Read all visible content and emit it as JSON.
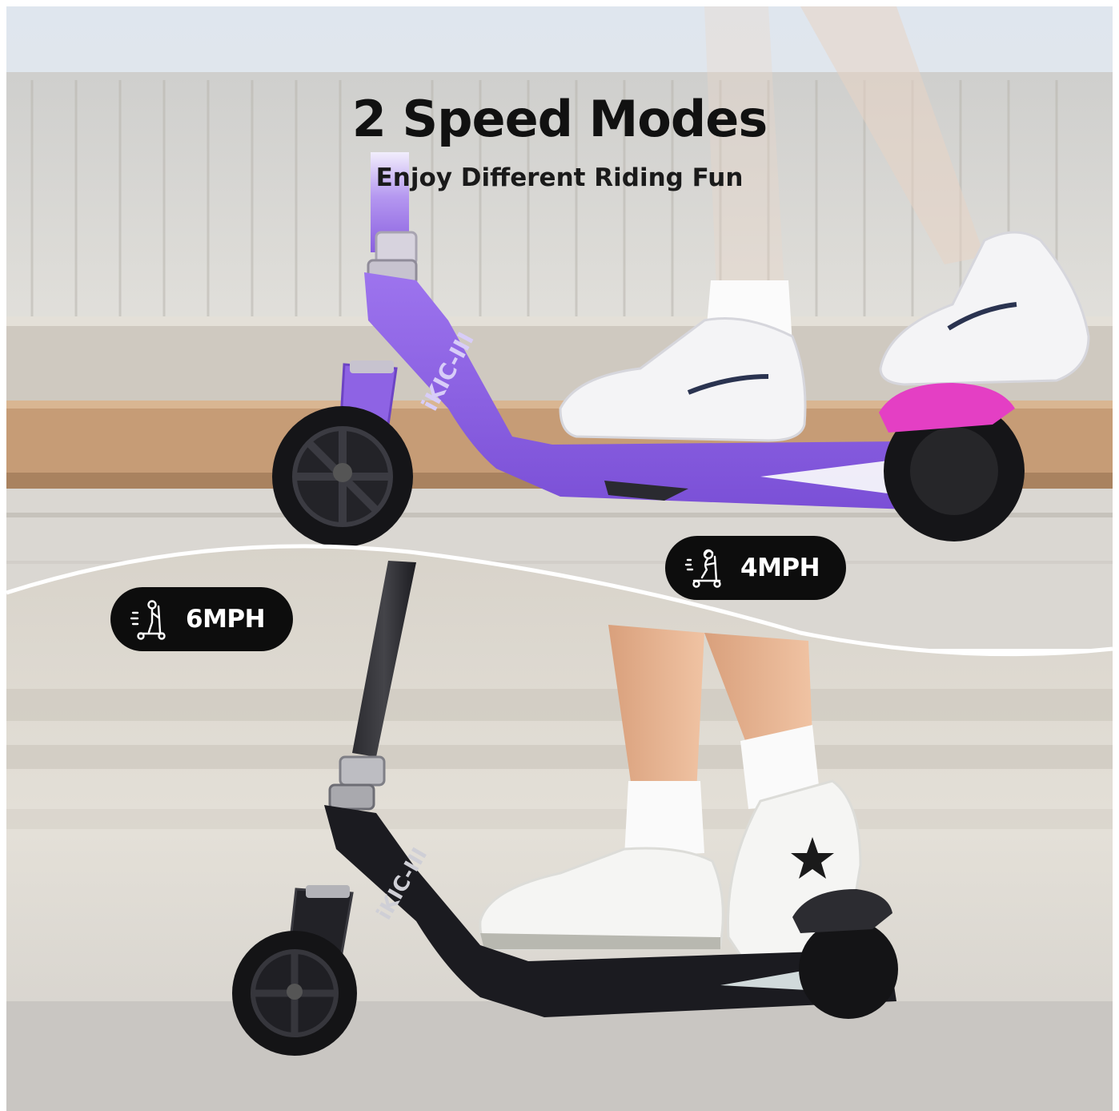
{
  "header": {
    "title": "2 Speed Modes",
    "subtitle": "Enjoy Different Riding Fun"
  },
  "badges": {
    "slow": {
      "label": "4MPH",
      "icon": "scooter-rider-icon"
    },
    "fast": {
      "label": "6MPH",
      "icon": "scooter-rider-icon"
    }
  },
  "scooters": {
    "top": {
      "brand_text": "iKIC-III",
      "color": "#8a5fe0",
      "accent": "#e43fc4"
    },
    "bottom": {
      "brand_text": "iKIC-III",
      "color": "#1a1a1f"
    }
  },
  "colors": {
    "badge_bg": "#0d0d0d",
    "badge_text": "#ffffff",
    "title_text": "#111111"
  }
}
